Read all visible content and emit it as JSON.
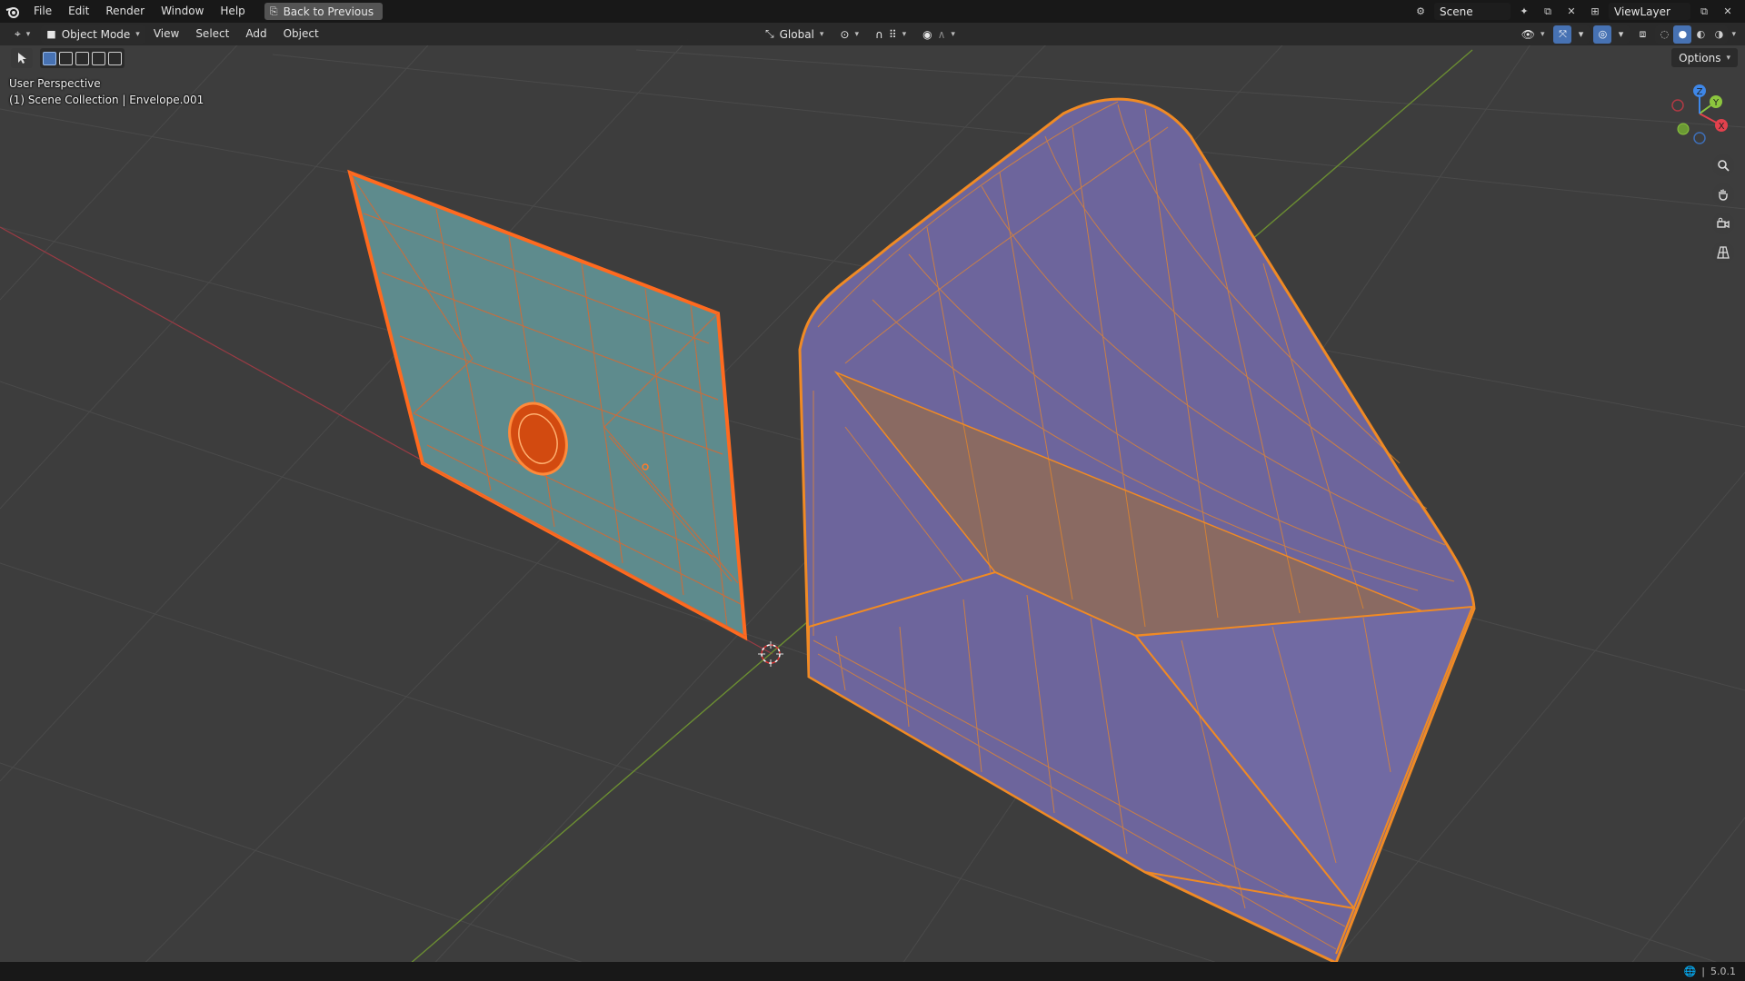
{
  "topbar": {
    "menus": [
      "File",
      "Edit",
      "Render",
      "Window",
      "Help"
    ],
    "back_label": "Back to Previous",
    "scene_name": "Scene",
    "view_layer": "ViewLayer"
  },
  "viewport_header": {
    "mode": "Object Mode",
    "menus": [
      "View",
      "Select",
      "Add",
      "Object"
    ],
    "transform_orientation": "Global",
    "options_label": "Options"
  },
  "overlay": {
    "perspective": "User Perspective",
    "collection_info": "(1) Scene Collection | Envelope.001"
  },
  "gizmo": {
    "axes": [
      "X",
      "Y",
      "Z"
    ],
    "colors": {
      "x": "#e3414d",
      "y": "#8cc63e",
      "z": "#3e87e8"
    }
  },
  "statusbar": {
    "version": "5.0.1"
  },
  "colors": {
    "selected_orange": "#f08a24",
    "active_outline": "#ff7a2a",
    "envelope_left_fill": "#5e8b8d",
    "envelope_right_fill": "#6d659c",
    "grid_bg": "#3d3d3d"
  }
}
